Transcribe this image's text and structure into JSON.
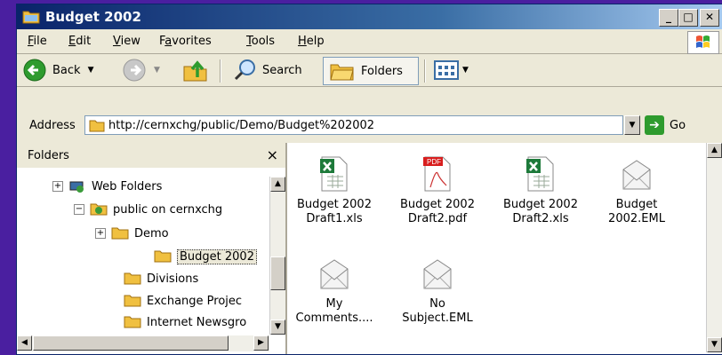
{
  "window": {
    "title": "Budget 2002",
    "buttons": [
      "_",
      "□",
      "x"
    ]
  },
  "menu": {
    "items": [
      {
        "label": "File",
        "accel": "F",
        "rest": "ile"
      },
      {
        "label": "Edit",
        "accel": "E",
        "rest": "dit"
      },
      {
        "label": "View",
        "accel": "V",
        "rest": "iew"
      },
      {
        "label": "Favorites",
        "pre": "F",
        "accel": "a",
        "rest": "vorites"
      },
      {
        "label": "Tools",
        "accel": "T",
        "rest": "ools"
      },
      {
        "label": "Help",
        "accel": "H",
        "rest": "elp"
      }
    ]
  },
  "toolbar": {
    "back_label": "Back",
    "search_label": "Search",
    "folders_label": "Folders"
  },
  "address": {
    "label": "Address",
    "value": "http://cernxchg/public/Demo/Budget%202002",
    "go_label": "Go"
  },
  "folders_pane": {
    "title": "Folders",
    "close": "×",
    "tree": [
      {
        "label": "Web Folders",
        "expander": "+",
        "icon": "web-folders-icon"
      },
      {
        "label": "public on cernxchg",
        "expander": "−",
        "icon": "network-folder-icon"
      },
      {
        "label": "Demo",
        "expander": "+",
        "icon": "folder-icon"
      },
      {
        "label": "Budget 2002",
        "expander": "",
        "icon": "folder-icon",
        "selected": true
      },
      {
        "label": "Divisions",
        "expander": "",
        "icon": "folder-icon"
      },
      {
        "label": "Exchange Projec",
        "expander": "",
        "icon": "folder-icon"
      },
      {
        "label": "Internet Newsgro",
        "expander": "",
        "icon": "folder-icon"
      }
    ]
  },
  "files": [
    {
      "line1": "Budget 2002",
      "line2": "Draft1.xls",
      "icon": "excel-icon"
    },
    {
      "line1": "Budget 2002",
      "line2": "Draft2.pdf",
      "icon": "pdf-icon",
      "badge": "PDF"
    },
    {
      "line1": "Budget 2002",
      "line2": "Draft2.xls",
      "icon": "excel-icon"
    },
    {
      "line1": "Budget",
      "line2": "2002.EML",
      "icon": "email-icon"
    },
    {
      "line1": "My",
      "line2": "Comments....",
      "icon": "email-icon"
    },
    {
      "line1": "No",
      "line2": "Subject.EML",
      "icon": "email-icon"
    }
  ],
  "colors": {
    "desktop": "#4a1fa0",
    "titlebar": "#0a246a",
    "folder": "#f0c040",
    "excel": "#1d7a3a",
    "pdf": "#d81e1e"
  }
}
